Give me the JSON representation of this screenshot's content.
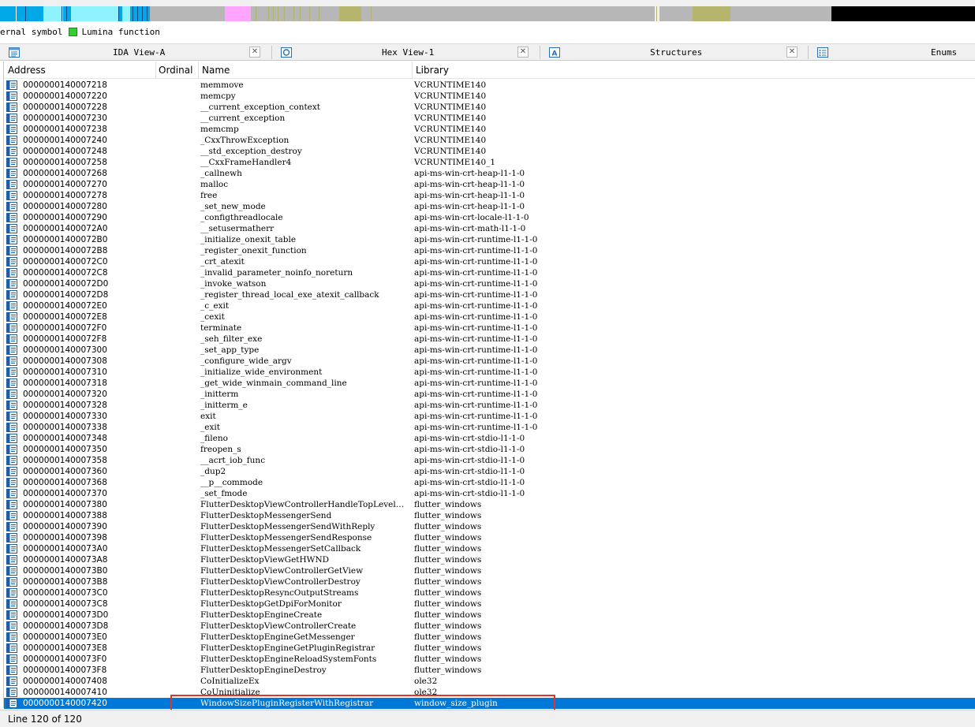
{
  "legend": {
    "items": [
      {
        "label": "ernal symbol",
        "color": ""
      },
      {
        "label": "Lumina function",
        "color": "#33cc33"
      }
    ]
  },
  "tabs": [
    {
      "label": "IDA View-A",
      "icon": "ida-view-icon",
      "closable": true
    },
    {
      "label": "Hex View-1",
      "icon": "hex-view-icon",
      "closable": true
    },
    {
      "label": "Structures",
      "icon": "structures-icon",
      "closable": true
    },
    {
      "label": "Enums",
      "icon": "enums-icon",
      "closable": false
    }
  ],
  "table": {
    "headers": {
      "address": "Address",
      "ordinal": "Ordinal",
      "name": "Name",
      "library": "Library"
    },
    "rows": [
      {
        "address": "0000000140007218",
        "ordinal": "",
        "name": "memmove",
        "library": "VCRUNTIME140"
      },
      {
        "address": "0000000140007220",
        "ordinal": "",
        "name": "memcpy",
        "library": "VCRUNTIME140"
      },
      {
        "address": "0000000140007228",
        "ordinal": "",
        "name": "__current_exception_context",
        "library": "VCRUNTIME140"
      },
      {
        "address": "0000000140007230",
        "ordinal": "",
        "name": "__current_exception",
        "library": "VCRUNTIME140"
      },
      {
        "address": "0000000140007238",
        "ordinal": "",
        "name": "memcmp",
        "library": "VCRUNTIME140"
      },
      {
        "address": "0000000140007240",
        "ordinal": "",
        "name": "_CxxThrowException",
        "library": "VCRUNTIME140"
      },
      {
        "address": "0000000140007248",
        "ordinal": "",
        "name": "__std_exception_destroy",
        "library": "VCRUNTIME140"
      },
      {
        "address": "0000000140007258",
        "ordinal": "",
        "name": "__CxxFrameHandler4",
        "library": "VCRUNTIME140_1"
      },
      {
        "address": "0000000140007268",
        "ordinal": "",
        "name": "_callnewh",
        "library": "api-ms-win-crt-heap-l1-1-0"
      },
      {
        "address": "0000000140007270",
        "ordinal": "",
        "name": "malloc",
        "library": "api-ms-win-crt-heap-l1-1-0"
      },
      {
        "address": "0000000140007278",
        "ordinal": "",
        "name": "free",
        "library": "api-ms-win-crt-heap-l1-1-0"
      },
      {
        "address": "0000000140007280",
        "ordinal": "",
        "name": "_set_new_mode",
        "library": "api-ms-win-crt-heap-l1-1-0"
      },
      {
        "address": "0000000140007290",
        "ordinal": "",
        "name": "_configthreadlocale",
        "library": "api-ms-win-crt-locale-l1-1-0"
      },
      {
        "address": "00000001400072A0",
        "ordinal": "",
        "name": "__setusermatherr",
        "library": "api-ms-win-crt-math-l1-1-0"
      },
      {
        "address": "00000001400072B0",
        "ordinal": "",
        "name": "_initialize_onexit_table",
        "library": "api-ms-win-crt-runtime-l1-1-0"
      },
      {
        "address": "00000001400072B8",
        "ordinal": "",
        "name": "_register_onexit_function",
        "library": "api-ms-win-crt-runtime-l1-1-0"
      },
      {
        "address": "00000001400072C0",
        "ordinal": "",
        "name": "_crt_atexit",
        "library": "api-ms-win-crt-runtime-l1-1-0"
      },
      {
        "address": "00000001400072C8",
        "ordinal": "",
        "name": "_invalid_parameter_noinfo_noreturn",
        "library": "api-ms-win-crt-runtime-l1-1-0"
      },
      {
        "address": "00000001400072D0",
        "ordinal": "",
        "name": "_invoke_watson",
        "library": "api-ms-win-crt-runtime-l1-1-0"
      },
      {
        "address": "00000001400072D8",
        "ordinal": "",
        "name": "_register_thread_local_exe_atexit_callback",
        "library": "api-ms-win-crt-runtime-l1-1-0"
      },
      {
        "address": "00000001400072E0",
        "ordinal": "",
        "name": "_c_exit",
        "library": "api-ms-win-crt-runtime-l1-1-0"
      },
      {
        "address": "00000001400072E8",
        "ordinal": "",
        "name": "_cexit",
        "library": "api-ms-win-crt-runtime-l1-1-0"
      },
      {
        "address": "00000001400072F0",
        "ordinal": "",
        "name": "terminate",
        "library": "api-ms-win-crt-runtime-l1-1-0"
      },
      {
        "address": "00000001400072F8",
        "ordinal": "",
        "name": "_seh_filter_exe",
        "library": "api-ms-win-crt-runtime-l1-1-0"
      },
      {
        "address": "0000000140007300",
        "ordinal": "",
        "name": "_set_app_type",
        "library": "api-ms-win-crt-runtime-l1-1-0"
      },
      {
        "address": "0000000140007308",
        "ordinal": "",
        "name": "_configure_wide_argv",
        "library": "api-ms-win-crt-runtime-l1-1-0"
      },
      {
        "address": "0000000140007310",
        "ordinal": "",
        "name": "_initialize_wide_environment",
        "library": "api-ms-win-crt-runtime-l1-1-0"
      },
      {
        "address": "0000000140007318",
        "ordinal": "",
        "name": "_get_wide_winmain_command_line",
        "library": "api-ms-win-crt-runtime-l1-1-0"
      },
      {
        "address": "0000000140007320",
        "ordinal": "",
        "name": "_initterm",
        "library": "api-ms-win-crt-runtime-l1-1-0"
      },
      {
        "address": "0000000140007328",
        "ordinal": "",
        "name": "_initterm_e",
        "library": "api-ms-win-crt-runtime-l1-1-0"
      },
      {
        "address": "0000000140007330",
        "ordinal": "",
        "name": "exit",
        "library": "api-ms-win-crt-runtime-l1-1-0"
      },
      {
        "address": "0000000140007338",
        "ordinal": "",
        "name": "_exit",
        "library": "api-ms-win-crt-runtime-l1-1-0"
      },
      {
        "address": "0000000140007348",
        "ordinal": "",
        "name": "_fileno",
        "library": "api-ms-win-crt-stdio-l1-1-0"
      },
      {
        "address": "0000000140007350",
        "ordinal": "",
        "name": "freopen_s",
        "library": "api-ms-win-crt-stdio-l1-1-0"
      },
      {
        "address": "0000000140007358",
        "ordinal": "",
        "name": "__acrt_iob_func",
        "library": "api-ms-win-crt-stdio-l1-1-0"
      },
      {
        "address": "0000000140007360",
        "ordinal": "",
        "name": "_dup2",
        "library": "api-ms-win-crt-stdio-l1-1-0"
      },
      {
        "address": "0000000140007368",
        "ordinal": "",
        "name": "__p__commode",
        "library": "api-ms-win-crt-stdio-l1-1-0"
      },
      {
        "address": "0000000140007370",
        "ordinal": "",
        "name": "_set_fmode",
        "library": "api-ms-win-crt-stdio-l1-1-0"
      },
      {
        "address": "0000000140007380",
        "ordinal": "",
        "name": "FlutterDesktopViewControllerHandleTopLevel…",
        "library": "flutter_windows"
      },
      {
        "address": "0000000140007388",
        "ordinal": "",
        "name": "FlutterDesktopMessengerSend",
        "library": "flutter_windows"
      },
      {
        "address": "0000000140007390",
        "ordinal": "",
        "name": "FlutterDesktopMessengerSendWithReply",
        "library": "flutter_windows"
      },
      {
        "address": "0000000140007398",
        "ordinal": "",
        "name": "FlutterDesktopMessengerSendResponse",
        "library": "flutter_windows"
      },
      {
        "address": "00000001400073A0",
        "ordinal": "",
        "name": "FlutterDesktopMessengerSetCallback",
        "library": "flutter_windows"
      },
      {
        "address": "00000001400073A8",
        "ordinal": "",
        "name": "FlutterDesktopViewGetHWND",
        "library": "flutter_windows"
      },
      {
        "address": "00000001400073B0",
        "ordinal": "",
        "name": "FlutterDesktopViewControllerGetView",
        "library": "flutter_windows"
      },
      {
        "address": "00000001400073B8",
        "ordinal": "",
        "name": "FlutterDesktopViewControllerDestroy",
        "library": "flutter_windows"
      },
      {
        "address": "00000001400073C0",
        "ordinal": "",
        "name": "FlutterDesktopResyncOutputStreams",
        "library": "flutter_windows"
      },
      {
        "address": "00000001400073C8",
        "ordinal": "",
        "name": "FlutterDesktopGetDpiForMonitor",
        "library": "flutter_windows"
      },
      {
        "address": "00000001400073D0",
        "ordinal": "",
        "name": "FlutterDesktopEngineCreate",
        "library": "flutter_windows"
      },
      {
        "address": "00000001400073D8",
        "ordinal": "",
        "name": "FlutterDesktopViewControllerCreate",
        "library": "flutter_windows"
      },
      {
        "address": "00000001400073E0",
        "ordinal": "",
        "name": "FlutterDesktopEngineGetMessenger",
        "library": "flutter_windows"
      },
      {
        "address": "00000001400073E8",
        "ordinal": "",
        "name": "FlutterDesktopEngineGetPluginRegistrar",
        "library": "flutter_windows"
      },
      {
        "address": "00000001400073F0",
        "ordinal": "",
        "name": "FlutterDesktopEngineReloadSystemFonts",
        "library": "flutter_windows"
      },
      {
        "address": "00000001400073F8",
        "ordinal": "",
        "name": "FlutterDesktopEngineDestroy",
        "library": "flutter_windows"
      },
      {
        "address": "0000000140007408",
        "ordinal": "",
        "name": "CoInitializeEx",
        "library": "ole32"
      },
      {
        "address": "0000000140007410",
        "ordinal": "",
        "name": "CoUninitialize",
        "library": "ole32"
      },
      {
        "address": "0000000140007420",
        "ordinal": "",
        "name": "WindowSizePluginRegisterWithRegistrar",
        "library": "window_size_plugin",
        "selected": true
      }
    ]
  },
  "status": {
    "text": "Line 120 of 120"
  },
  "colors": {
    "selection": "#0078d7",
    "highlight_box": "#e0352b",
    "lumina": "#33cc33"
  }
}
